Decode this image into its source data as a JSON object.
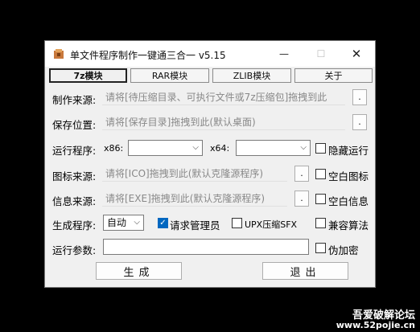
{
  "window": {
    "title": "单文件程序制作一键通三合一 v5.15",
    "minimize_glyph": "—",
    "maximize_glyph": "☐",
    "close_glyph": "✕"
  },
  "tabs": [
    "7z模块",
    "RAR模块",
    "ZLIB模块",
    "关于"
  ],
  "active_tab": "7z模块",
  "form": {
    "source_label": "制作来源:",
    "source_placeholder": "请将[待压缩目录、可执行文件或7z压缩包]拖拽到此",
    "save_label": "保存位置:",
    "save_placeholder": "请将[保存目录]拖拽到此(默认桌面)",
    "run_label": "运行程序:",
    "x86_label": "x86:",
    "x64_label": "x64:",
    "hide_run_label": "隐藏运行",
    "icon_label": "图标来源:",
    "icon_placeholder": "请将[ICO]拖拽到此(默认克隆源程序)",
    "blank_icon_label": "空白图标",
    "info_label": "信息来源:",
    "info_placeholder": "请将[EXE]拖拽到此(默认克隆源程序)",
    "blank_info_label": "空白信息",
    "gen_label": "生成程序:",
    "gen_value": "自动",
    "admin_label": "请求管理员",
    "upx_label": "UPX压缩SFX",
    "compat_label": "兼容算法",
    "params_label": "运行参数:",
    "params_value": "",
    "fake_encrypt_label": "伪加密",
    "dot": "."
  },
  "checkboxes": {
    "hide_run": false,
    "blank_icon": false,
    "blank_info": false,
    "admin": true,
    "upx": false,
    "compat": false,
    "fake_encrypt": false
  },
  "buttons": {
    "generate": "生成",
    "exit": "退出"
  },
  "watermark": {
    "line1": "吾爱破解论坛",
    "line2": "www.52pojie.cn"
  },
  "colors": {
    "accent": "#0067c0",
    "background": "#000000",
    "window": "#f0f0f0"
  }
}
